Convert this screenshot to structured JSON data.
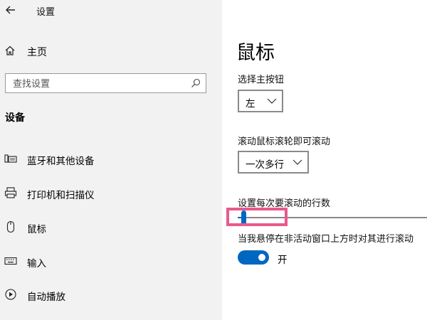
{
  "app": {
    "title": "设置"
  },
  "sidebar": {
    "home_label": "主页",
    "search_placeholder": "查找设置",
    "section_title": "设备",
    "items": [
      {
        "label": "蓝牙和其他设备",
        "icon": "bluetooth-devices-icon"
      },
      {
        "label": "打印机和扫描仪",
        "icon": "printer-icon"
      },
      {
        "label": "鼠标",
        "icon": "mouse-icon"
      },
      {
        "label": "输入",
        "icon": "keyboard-icon"
      },
      {
        "label": "自动播放",
        "icon": "autoplay-icon"
      }
    ]
  },
  "main": {
    "title": "鼠标",
    "primary_button": {
      "label": "选择主按钮",
      "value": "左"
    },
    "wheel_scroll": {
      "label": "滚动鼠标滚轮即可滚动",
      "value": "一次多行"
    },
    "lines_to_scroll": {
      "label": "设置每次要滚动的行数",
      "slider_fraction": 0.03
    },
    "inactive_scroll": {
      "label": "当我悬停在非活动窗口上方时对其进行滚动",
      "state_label": "开",
      "on": true
    }
  },
  "colors": {
    "accent": "#0067c0",
    "highlight": "#e8598d",
    "sidebar_bg": "#f2f2f2"
  }
}
